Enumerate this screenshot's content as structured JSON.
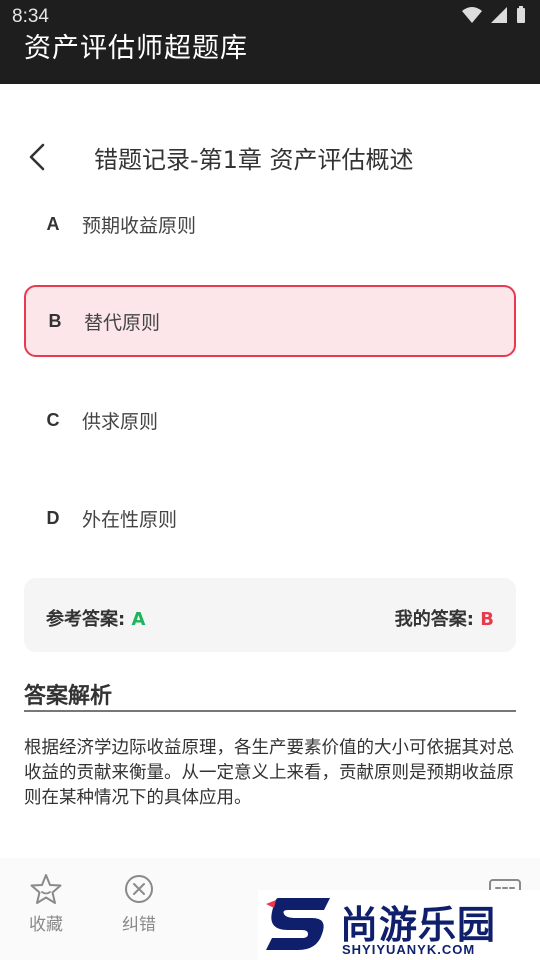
{
  "status_bar": {
    "time": "8:34"
  },
  "app": {
    "title": "资产评估师超题库"
  },
  "nav": {
    "back_icon": "chevron-left-icon",
    "title": "错题记录-第1章 资产评估概述"
  },
  "options": [
    {
      "letter": "A",
      "text": "预期收益原则",
      "state": "normal"
    },
    {
      "letter": "B",
      "text": "替代原则",
      "state": "wrong"
    },
    {
      "letter": "C",
      "text": "供求原则",
      "state": "normal"
    },
    {
      "letter": "D",
      "text": "外在性原则",
      "state": "normal"
    }
  ],
  "answers": {
    "reference_label": "参考答案:",
    "reference_value": "A",
    "mine_label": "我的答案:",
    "mine_value": "B"
  },
  "analysis": {
    "title": "答案解析",
    "text": "根据经济学边际收益原理，各生产要素价值的大小可依据其对总收益的贡献来衡量。从一定意义上来看，贡献原则是预期收益原则在某种情况下的具体应用。"
  },
  "bottom_bar": {
    "collect_label": "收藏",
    "correct_label": "纠错"
  },
  "watermark": {
    "text": "尚游乐园",
    "url": "SHYIYUANYK.COM"
  },
  "colors": {
    "wrong": "#e8394f",
    "correct": "#1fb35b",
    "appbar": "#1e1e1e"
  }
}
